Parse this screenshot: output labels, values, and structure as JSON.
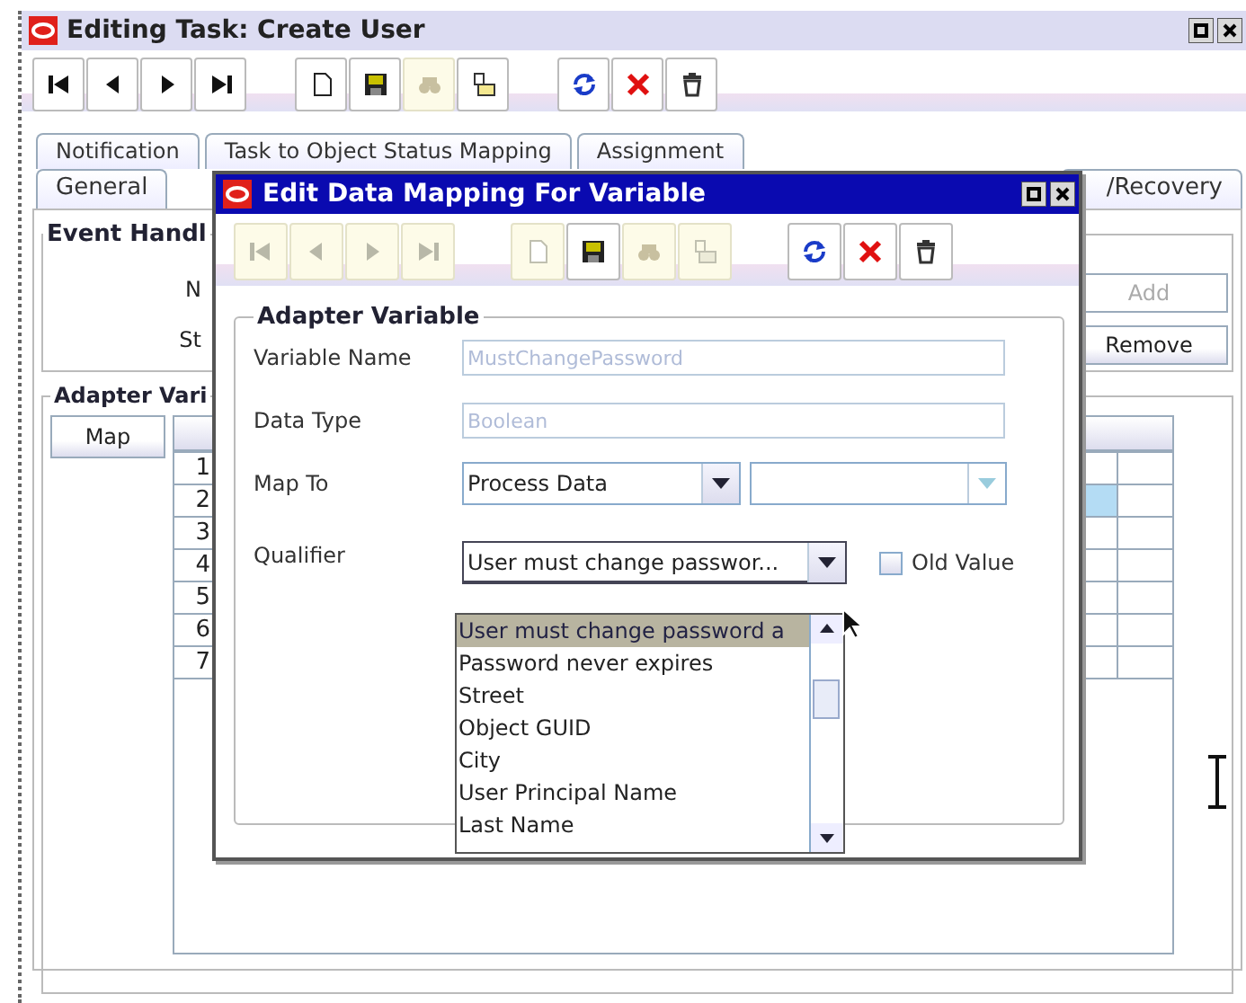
{
  "window": {
    "title": "Editing Task: Create User"
  },
  "toolbar": [
    {
      "kind": "first",
      "disabled": false
    },
    {
      "kind": "previous",
      "disabled": false
    },
    {
      "kind": "next",
      "disabled": false
    },
    {
      "kind": "last",
      "disabled": false
    },
    {
      "kind": "new",
      "disabled": false
    },
    {
      "kind": "save",
      "disabled": false
    },
    {
      "kind": "find",
      "disabled": true
    },
    {
      "kind": "assign",
      "disabled": false
    },
    {
      "kind": "refresh",
      "disabled": false
    },
    {
      "kind": "delete",
      "disabled": false
    },
    {
      "kind": "trash",
      "disabled": false
    }
  ],
  "tabs_top_row": [
    {
      "label": "Notification"
    },
    {
      "label": "Task to Object Status Mapping"
    },
    {
      "label": "Assignment"
    }
  ],
  "tabs_bottom_row": [
    {
      "label": "General"
    },
    {
      "label": "/Recovery"
    }
  ],
  "event_handler": {
    "title": "Event Handl",
    "labels": [
      "N",
      "St"
    ],
    "buttons": [
      {
        "label": "Add",
        "disabled": true
      },
      {
        "label": "Remove",
        "disabled": false
      }
    ]
  },
  "adapter_variables": {
    "title": "Adapter Vari",
    "map_button": "Map",
    "rows": [
      {
        "number": "1",
        "selected": false
      },
      {
        "number": "2",
        "selected": true
      },
      {
        "number": "3",
        "selected": false
      },
      {
        "number": "4",
        "selected": false
      },
      {
        "number": "5",
        "selected": false
      },
      {
        "number": "6",
        "selected": false
      },
      {
        "number": "7",
        "selected": false
      }
    ]
  },
  "dialog": {
    "title": "Edit Data Mapping For Variable",
    "toolbar": [
      {
        "kind": "first",
        "disabled": true
      },
      {
        "kind": "previous",
        "disabled": true
      },
      {
        "kind": "next",
        "disabled": true
      },
      {
        "kind": "last",
        "disabled": true
      },
      {
        "kind": "new",
        "disabled": true
      },
      {
        "kind": "save",
        "disabled": false
      },
      {
        "kind": "find",
        "disabled": true
      },
      {
        "kind": "assign",
        "disabled": true
      },
      {
        "kind": "refresh",
        "disabled": false
      },
      {
        "kind": "delete",
        "disabled": false
      },
      {
        "kind": "trash",
        "disabled": false
      }
    ],
    "group_title": "Adapter Variable",
    "variable_name": {
      "label": "Variable Name",
      "value": "MustChangePassword",
      "disabled": true
    },
    "data_type": {
      "label": "Data Type",
      "value": "Boolean",
      "disabled": true
    },
    "map_to": {
      "label": "Map To",
      "value": "Process Data",
      "second_value_disabled": true
    },
    "qualifier": {
      "label": "Qualifier",
      "value": "User must change passwor...",
      "expanded": true,
      "options": [
        {
          "label": "User must change password a",
          "selected": true
        },
        {
          "label": "Password never expires",
          "selected": false
        },
        {
          "label": "Street",
          "selected": false
        },
        {
          "label": "Object GUID",
          "selected": false
        },
        {
          "label": "City",
          "selected": false
        },
        {
          "label": "User Principal Name",
          "selected": false
        },
        {
          "label": "Last Name",
          "selected": false
        }
      ]
    },
    "old_value": {
      "label": "Old Value",
      "checked": false
    }
  }
}
